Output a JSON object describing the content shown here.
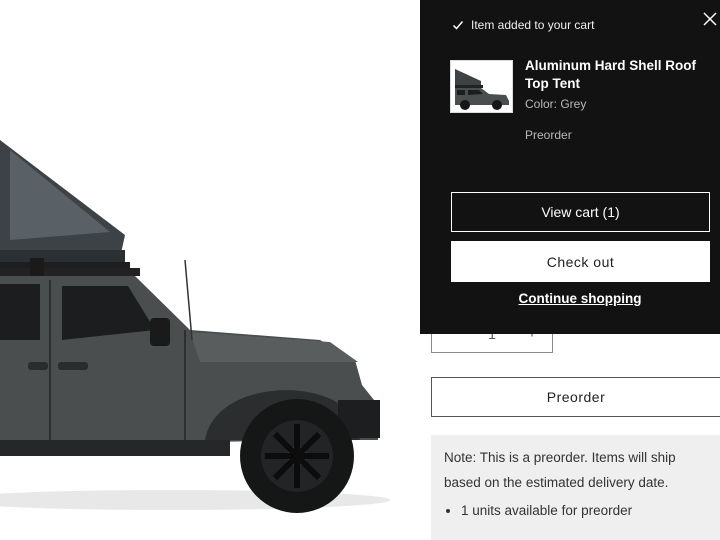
{
  "cart_popup": {
    "header": "Item added to your cart",
    "item": {
      "title": "Aluminum Hard Shell Roof Top Tent",
      "color": "Color: Grey",
      "status": "Preorder"
    },
    "view_cart_label": "View cart (1)",
    "checkout_label": "Check out",
    "continue_label": "Continue shopping"
  },
  "product": {
    "quantity": "1",
    "qty_minus": "−",
    "qty_plus": "+",
    "preorder_label": "Preorder",
    "note": "Note: This is a preorder. Items will ship based on the estimated delivery date.",
    "availability": "1 units available for preorder"
  },
  "colors": {
    "popup_bg": "#121212",
    "vehicle": "#4a4d4d",
    "note_bg": "#efefef"
  }
}
